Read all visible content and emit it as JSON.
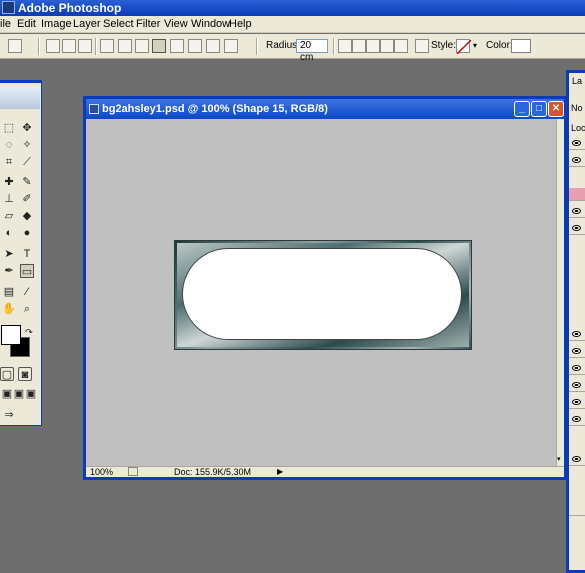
{
  "app": {
    "title": "Adobe Photoshop"
  },
  "menu": [
    "ile",
    "Edit",
    "Image",
    "Layer",
    "Select",
    "Filter",
    "View",
    "Window",
    "Help"
  ],
  "options_bar": {
    "radius_label": "Radius:",
    "radius_value": "20 cm",
    "style_label": "Style:",
    "color_label": "Color:"
  },
  "document": {
    "title": "bg2ahsley1.psd @ 100% (Shape 15, RGB/8)",
    "zoom": "100%",
    "doc_info": "Doc: 155.9K/5.30M",
    "window_buttons": {
      "minimize": "_",
      "maximize": "□",
      "close": "✕"
    }
  },
  "layers_panel": {
    "tab_label": "La",
    "lock_label": "Loc",
    "blend_label": "No"
  },
  "colors": {
    "titlebar": "#0a3bb8",
    "workspace": "#6e6e6e",
    "canvas_bg": "#c0c0c0",
    "shape_fill": "#ffffff"
  },
  "icons": {
    "tools": [
      "marquee-icon",
      "move-icon",
      "lasso-icon",
      "magic-wand-icon",
      "crop-icon",
      "slice-icon",
      "healing-icon",
      "brush-icon",
      "stamp-icon",
      "history-brush-icon",
      "eraser-icon",
      "paint-bucket-icon",
      "blur-icon",
      "dodge-icon",
      "path-selection-icon",
      "type-icon",
      "pen-icon",
      "shape-icon",
      "notes-icon",
      "eyedropper-icon",
      "hand-icon",
      "zoom-icon"
    ]
  }
}
